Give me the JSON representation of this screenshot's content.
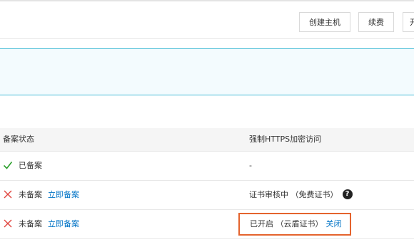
{
  "toolbar": {
    "create_label": "创建主机",
    "renew_label": "续费",
    "more_label": "开"
  },
  "table": {
    "headers": {
      "record_status": "备案状态",
      "https_access": "强制HTTPS加密访问"
    },
    "rows": [
      {
        "status_icon": "check-icon",
        "record_status": "已备案",
        "record_link": "",
        "https": "-"
      },
      {
        "status_icon": "cross-icon",
        "record_status": "未备案",
        "record_link": "立即备案",
        "https": "证书审核中 （免费证书）"
      },
      {
        "status_icon": "cross-icon",
        "record_status": "未备案",
        "record_link": "立即备案",
        "https": "已开启 （云盾证书）",
        "https_action": "关闭"
      }
    ]
  },
  "help_icon": {
    "glyph": "?"
  },
  "colors": {
    "link": "#0073c6",
    "success": "#2ca02c",
    "error": "#e0443e",
    "panel_border": "#44bcd6",
    "highlight_border": "#e4632d"
  }
}
